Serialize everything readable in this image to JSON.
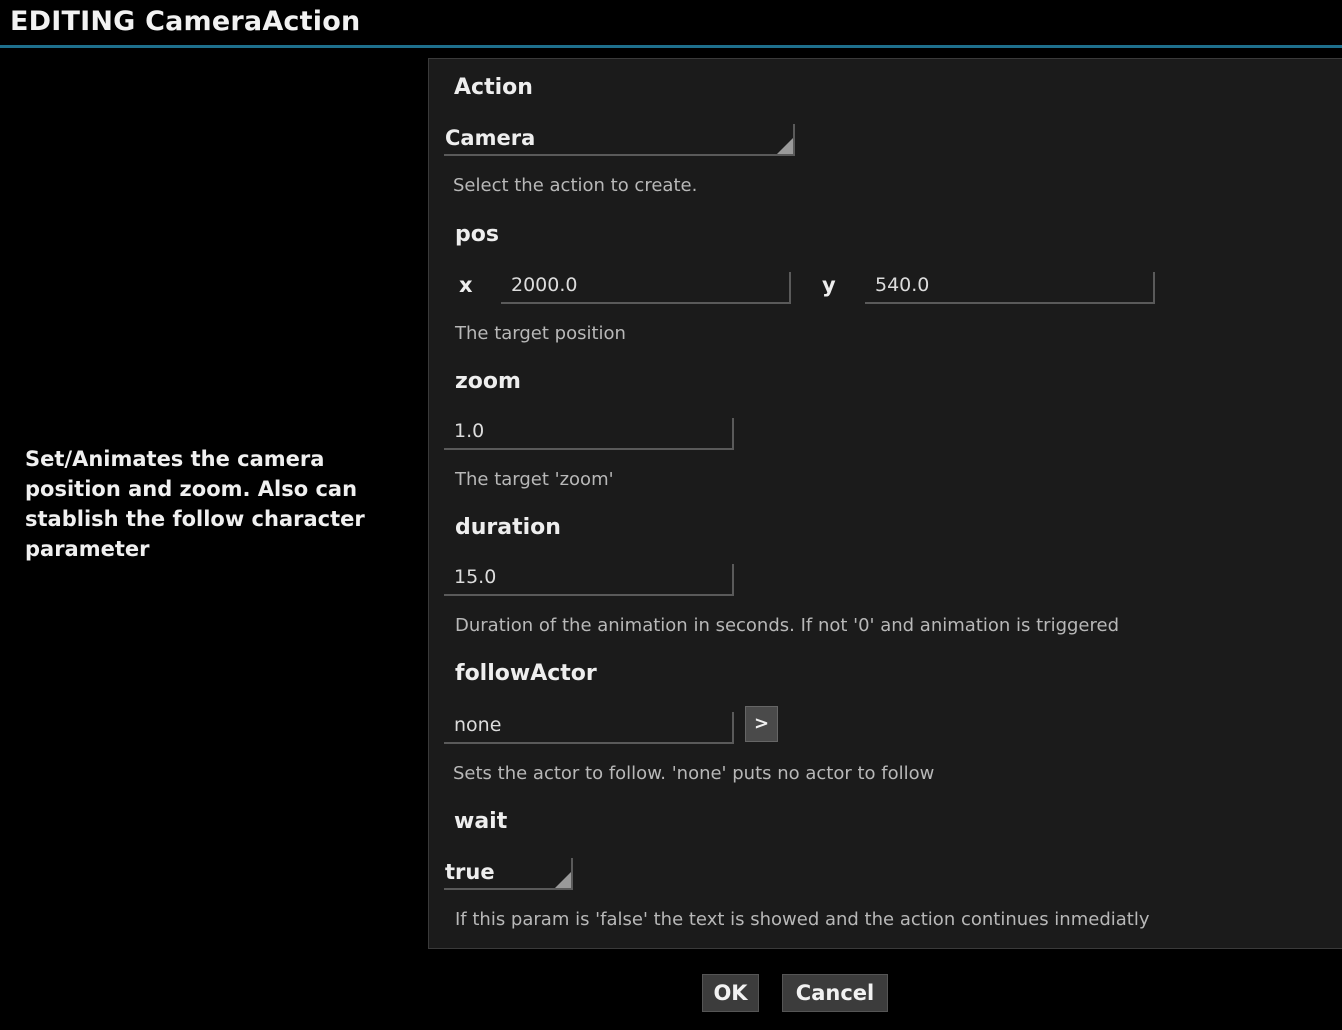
{
  "window": {
    "title": "EDITING CameraAction"
  },
  "description": "Set/Animates the camera position and zoom. Also can stablish the follow character parameter",
  "form": {
    "action": {
      "label": "Action",
      "value": "Camera",
      "help": "Select the action to create."
    },
    "pos": {
      "label": "pos",
      "x_label": "x",
      "x_value": "2000.0",
      "y_label": "y",
      "y_value": "540.0",
      "help": "The target position"
    },
    "zoom": {
      "label": "zoom",
      "value": "1.0",
      "help": "The target 'zoom'"
    },
    "duration": {
      "label": "duration",
      "value": "15.0",
      "help": "Duration of the animation in seconds. If not '0' and animation is triggered"
    },
    "followActor": {
      "label": "followActor",
      "value": "none",
      "picker_label": ">",
      "help": "Sets the actor to follow. 'none' puts no actor to follow"
    },
    "wait": {
      "label": "wait",
      "value": "true",
      "help": "If this param is 'false' the text is showed and the action continues inmediatly"
    }
  },
  "buttons": {
    "ok": "OK",
    "cancel": "Cancel"
  },
  "colors": {
    "background": "#000000",
    "panel": "#1b1b1b",
    "title_accent": "#1e6f8c",
    "button": "#3c3c3c"
  }
}
